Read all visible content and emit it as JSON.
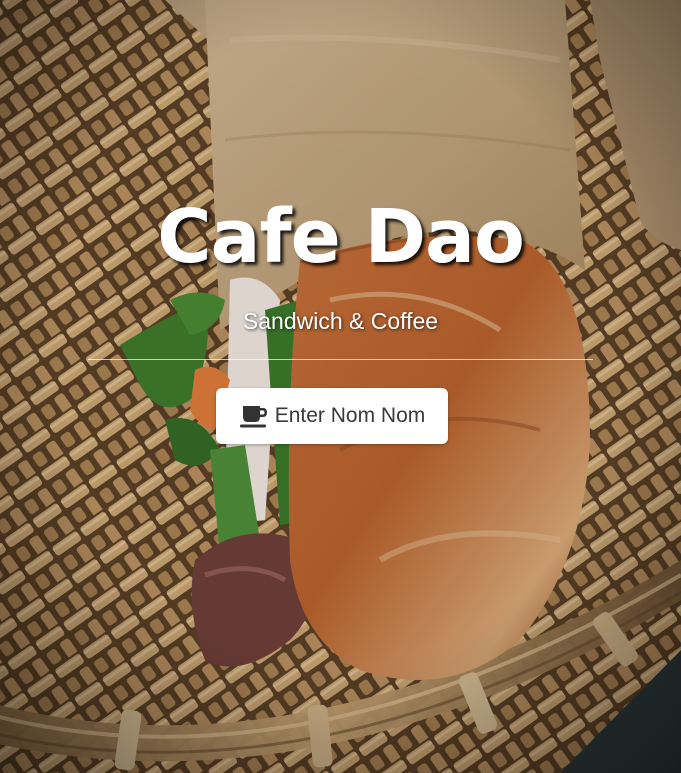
{
  "hero": {
    "title": "Cafe Dao",
    "subtitle": "Sandwich & Coffee",
    "cta_label": "Enter Nom Nom",
    "cta_icon": "coffee-cup-icon"
  },
  "colors": {
    "title_text": "#ffffff",
    "button_bg": "#ffffff",
    "button_text": "#3a3a3a"
  }
}
